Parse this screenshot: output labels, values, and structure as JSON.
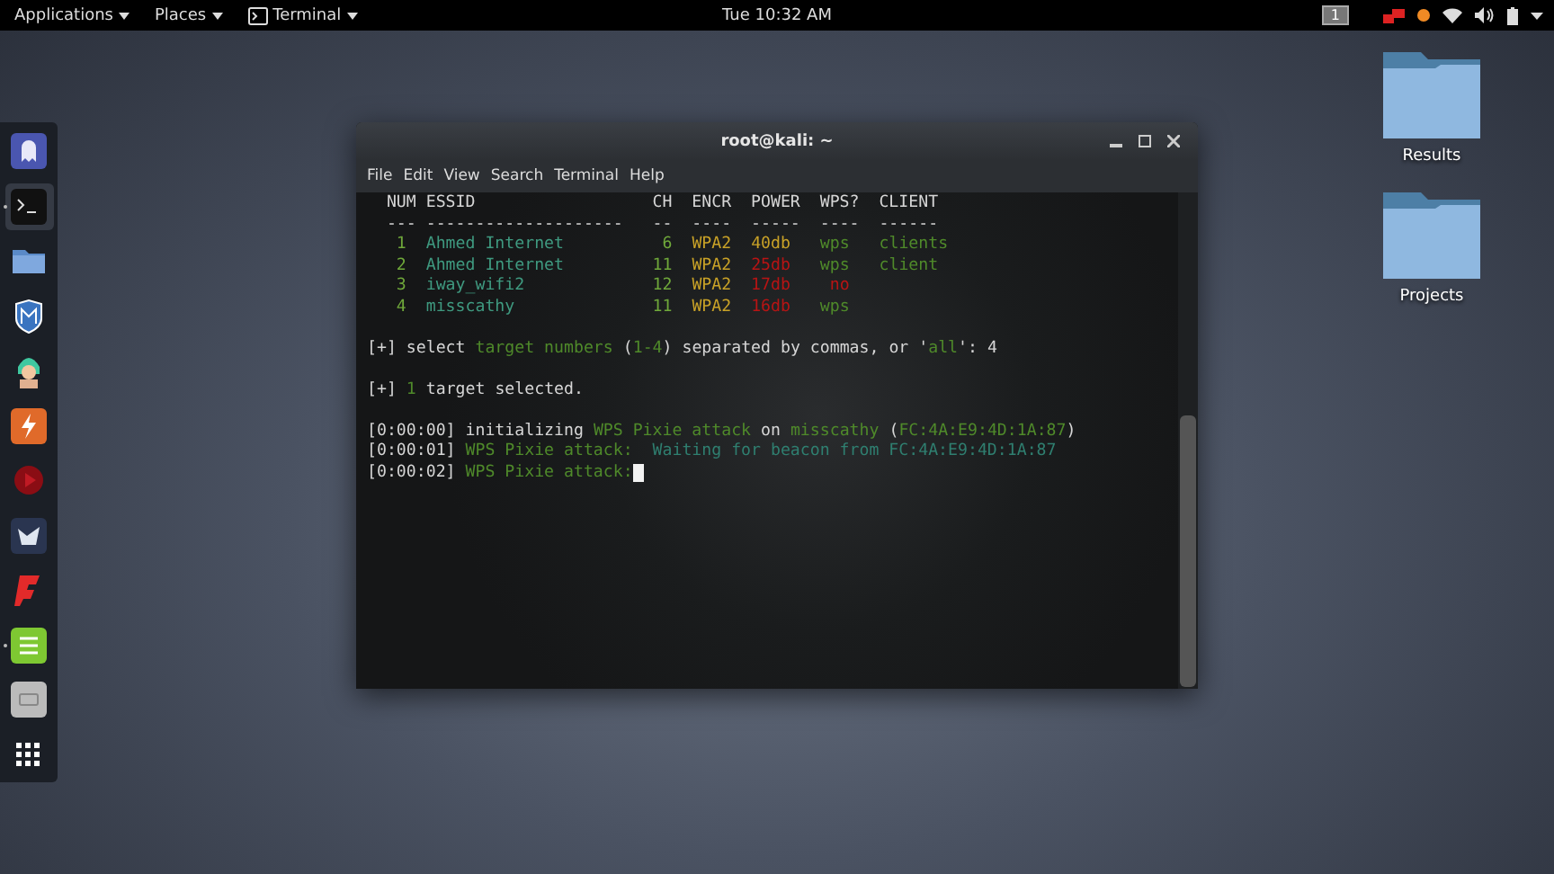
{
  "top_bar": {
    "menus": [
      {
        "label": "Applications",
        "kind": "text"
      },
      {
        "label": "Places",
        "kind": "text"
      },
      {
        "label": "Terminal",
        "kind": "app"
      }
    ],
    "clock": "Tue 10:32 AM",
    "workspace": "1"
  },
  "dock": [
    {
      "kind": "ghost",
      "running": false,
      "selected": false
    },
    {
      "kind": "terminal",
      "running": true,
      "selected": true
    },
    {
      "kind": "folder",
      "running": false,
      "selected": false
    },
    {
      "kind": "shield",
      "running": false,
      "selected": false
    },
    {
      "kind": "avatar",
      "running": false,
      "selected": false
    },
    {
      "kind": "burp",
      "running": false,
      "selected": false
    },
    {
      "kind": "record",
      "running": false,
      "selected": false
    },
    {
      "kind": "beast",
      "running": false,
      "selected": false
    },
    {
      "kind": "flash",
      "running": false,
      "selected": false
    },
    {
      "kind": "notes",
      "running": true,
      "selected": false
    },
    {
      "kind": "disk",
      "running": false,
      "selected": false
    },
    {
      "kind": "grid",
      "running": false,
      "selected": false
    }
  ],
  "window": {
    "title": "root@kali: ~",
    "menu": [
      "File",
      "Edit",
      "View",
      "Search",
      "Terminal",
      "Help"
    ],
    "blocks": [
      [
        {
          "segments": [
            {
              "text": "  NUM ESSID                  CH  ENCR  POWER  WPS?  CLIENT",
              "color": "#d6d6d6"
            }
          ]
        },
        {
          "segments": [
            {
              "text": "  --- --------------------   --  ----  -----  ----  ------"
            }
          ]
        },
        {
          "segments": [
            {
              "text": "   1  ",
              "color": "#6fa83a"
            },
            {
              "text": "Ahmed Internet",
              "color": "#3f9a80"
            },
            {
              "text": "          6  ",
              "color": "#6fa83a"
            },
            {
              "text": "WPA2  ",
              "color": "#c9a227"
            },
            {
              "text": "40db",
              "color": "#c9a227"
            },
            {
              "text": "   wps   ",
              "color": "#4f8a2a"
            },
            {
              "text": "clients",
              "color": "#4f8a2a"
            }
          ]
        },
        {
          "segments": [
            {
              "text": "   2  ",
              "color": "#6fa83a"
            },
            {
              "text": "Ahmed Internet",
              "color": "#3f9a80"
            },
            {
              "text": "         11  ",
              "color": "#6fa83a"
            },
            {
              "text": "WPA2  ",
              "color": "#c9a227"
            },
            {
              "text": "25db",
              "color": "#b81414"
            },
            {
              "text": "   wps   ",
              "color": "#4f8a2a"
            },
            {
              "text": "client",
              "color": "#4f8a2a"
            }
          ]
        },
        {
          "segments": [
            {
              "text": "   3  ",
              "color": "#6fa83a"
            },
            {
              "text": "iway_wifi2",
              "color": "#3f9a80"
            },
            {
              "text": "             12  ",
              "color": "#6fa83a"
            },
            {
              "text": "WPA2  ",
              "color": "#c9a227"
            },
            {
              "text": "17db",
              "color": "#b81414"
            },
            {
              "text": "    no",
              "color": "#b81414"
            }
          ]
        },
        {
          "segments": [
            {
              "text": "   4  ",
              "color": "#6fa83a"
            },
            {
              "text": "misscathy",
              "color": "#3f9a80"
            },
            {
              "text": "              11  ",
              "color": "#6fa83a"
            },
            {
              "text": "WPA2  ",
              "color": "#c9a227"
            },
            {
              "text": "16db",
              "color": "#b81414"
            },
            {
              "text": "   wps",
              "color": "#4f8a2a"
            }
          ]
        }
      ],
      [
        {
          "segments": [
            {
              "text": "[+] select ",
              "color": "#d6d6d6"
            },
            {
              "text": "target numbers",
              "color": "#4f8a2a"
            },
            {
              "text": " (",
              "color": "#d6d6d6"
            },
            {
              "text": "1-4",
              "color": "#4f8a2a"
            },
            {
              "text": ") separated by commas, or '",
              "color": "#d6d6d6"
            },
            {
              "text": "all",
              "color": "#4f8a2a"
            },
            {
              "text": "': 4",
              "color": "#d6d6d6"
            }
          ]
        }
      ],
      [
        {
          "segments": [
            {
              "text": "[+] ",
              "color": "#d6d6d6"
            },
            {
              "text": "1",
              "color": "#4f8a2a"
            },
            {
              "text": " target selected.",
              "color": "#d6d6d6"
            }
          ]
        }
      ],
      [
        {
          "segments": [
            {
              "text": "[0:00:00] initializing ",
              "color": "#d6d6d6"
            },
            {
              "text": "WPS Pixie attack",
              "color": "#4f8a2a"
            },
            {
              "text": " on ",
              "color": "#d6d6d6"
            },
            {
              "text": "misscathy",
              "color": "#4f8a2a"
            },
            {
              "text": " (",
              "color": "#d6d6d6"
            },
            {
              "text": "FC:4A:E9:4D:1A:87",
              "color": "#4f8a2a"
            },
            {
              "text": ")",
              "color": "#d6d6d6"
            }
          ]
        },
        {
          "segments": [
            {
              "text": "[0:00:01] ",
              "color": "#d6d6d6"
            },
            {
              "text": "WPS Pixie attack:",
              "color": "#4f8a2a"
            },
            {
              "text": "  Waiting for beacon from FC:4A:E9:4D:1A:87",
              "color": "#2f7f70"
            }
          ]
        },
        {
          "segments": [
            {
              "text": "[0:00:02] ",
              "color": "#d6d6d6"
            },
            {
              "text": "WPS Pixie attack:",
              "color": "#4f8a2a"
            }
          ],
          "cursor": true
        }
      ]
    ]
  },
  "desktop_icons": [
    {
      "label": "Results"
    },
    {
      "label": "Projects"
    }
  ]
}
